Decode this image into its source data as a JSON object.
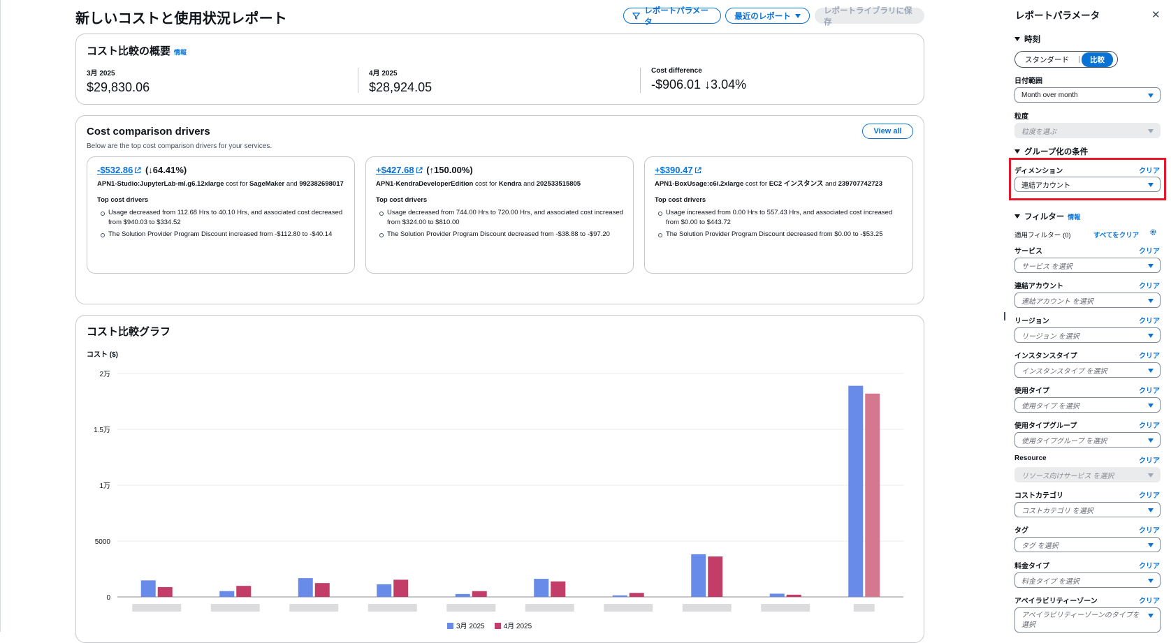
{
  "header": {
    "title": "新しいコストと使用状況レポート",
    "btn_params": "レポートパラメータ",
    "btn_recent": "最近のレポート",
    "btn_save": "レポートライブラリに保存"
  },
  "overview": {
    "title": "コスト比較の概要",
    "info": "情報",
    "metrics": [
      {
        "label": "3月 2025",
        "value": "$29,830.06"
      },
      {
        "label": "4月 2025",
        "value": "$28,924.05"
      },
      {
        "label": "Cost difference",
        "value": "-$906.01 ↓3.04%"
      }
    ]
  },
  "drivers": {
    "title": "Cost comparison drivers",
    "subtitle": "Below are the top cost comparison drivers for your services.",
    "view_all": "View all",
    "top_label": "Top cost drivers",
    "cards": [
      {
        "amount": "-$532.86",
        "pct": "(↓64.41%)",
        "usage": "APN1-Studio:JupyterLab-ml.g6.12xlarge",
        "mid": " cost for ",
        "service": "SageMaker",
        "and": " and ",
        "account": "992382698017",
        "bullets": [
          "Usage decreased from 112.68 Hrs to 40.10 Hrs, and associated cost decreased from $940.03 to $334.52",
          "The Solution Provider Program Discount increased from -$112.80 to -$40.14"
        ]
      },
      {
        "amount": "+$427.68",
        "pct": "(↑150.00%)",
        "usage": "APN1-KendraDeveloperEdition",
        "mid": " cost for ",
        "service": "Kendra",
        "and": " and ",
        "account": "202533515805",
        "bullets": [
          "Usage decreased from 744.00 Hrs to 720.00 Hrs, and associated cost increased from $324.00 to $810.00",
          "The Solution Provider Program Discount decreased from -$38.88 to -$97.20"
        ]
      },
      {
        "amount": "+$390.47",
        "pct": "",
        "usage": "APN1-BoxUsage:c6i.2xlarge",
        "mid": " cost for ",
        "service": "EC2 インスタンス",
        "and": " and ",
        "account": "239707742723",
        "bullets": [
          "Usage increased from 0.00 Hrs to 557.43 Hrs, and associated cost increased from $0.00 to $443.72",
          "The Solution Provider Program Discount decreased from $0.00 to -$53.25"
        ]
      }
    ]
  },
  "chart_section": {
    "title": "コスト比較グラフ",
    "ylabel": "コスト ($)"
  },
  "chart_data": {
    "type": "bar",
    "ylabel": "コスト ($)",
    "ylim": [
      0,
      20000
    ],
    "yticks": [
      "0",
      "5000",
      "1万",
      "1.5万",
      "2万"
    ],
    "ytick_values": [
      0,
      5000,
      10000,
      15000,
      20000
    ],
    "categories": [
      "",
      "",
      "",
      "",
      "",
      "",
      "",
      "",
      "",
      ""
    ],
    "series": [
      {
        "name": "3月 2025",
        "color": "#688ae8",
        "values": [
          1480,
          520,
          1680,
          1130,
          260,
          1620,
          140,
          3820,
          290,
          18900
        ]
      },
      {
        "name": "4月 2025",
        "color": "#c33d69",
        "values": [
          880,
          990,
          1240,
          1540,
          520,
          1390,
          360,
          3620,
          200,
          18200
        ]
      }
    ],
    "legend": "bottom-center",
    "grid": true
  },
  "panel": {
    "title": "レポートパラメータ",
    "time_section": "時刻",
    "seg_standard": "スタンダード",
    "seg_compare": "比較",
    "date_range_label": "日付範囲",
    "date_range_value": "Month over month",
    "granularity_label": "粒度",
    "granularity_placeholder": "粒度を選ぶ",
    "group_section": "グループ化の条件",
    "dimension_label": "ディメンション",
    "dimension_value": "連結アカウント",
    "clear": "クリア",
    "filter_section": "フィルター",
    "info": "情報",
    "applied": "適用フィルター (0)",
    "clear_all": "すべてをクリア",
    "filters": [
      {
        "label": "サービス",
        "placeholder": "サービス を選択"
      },
      {
        "label": "連結アカウント",
        "placeholder": "連結アカウント を選択"
      },
      {
        "label": "リージョン",
        "placeholder": "リージョン を選択"
      },
      {
        "label": "インスタンスタイプ",
        "placeholder": "インスタンスタイプ を選択"
      },
      {
        "label": "使用タイプ",
        "placeholder": "使用タイプ を選択"
      },
      {
        "label": "使用タイプグループ",
        "placeholder": "使用タイプグループ を選択"
      },
      {
        "label": "Resource",
        "placeholder": "リソース向けサービス を選択"
      },
      {
        "label": "コストカテゴリ",
        "placeholder": "コストカテゴリ を選択"
      },
      {
        "label": "タグ",
        "placeholder": "タグ を選択"
      },
      {
        "label": "料金タイプ",
        "placeholder": "料金タイプ を選択"
      },
      {
        "label": "アベイラビリティーゾーン",
        "placeholder": "アベイラビリティーゾーンのタイプを選択"
      }
    ]
  }
}
